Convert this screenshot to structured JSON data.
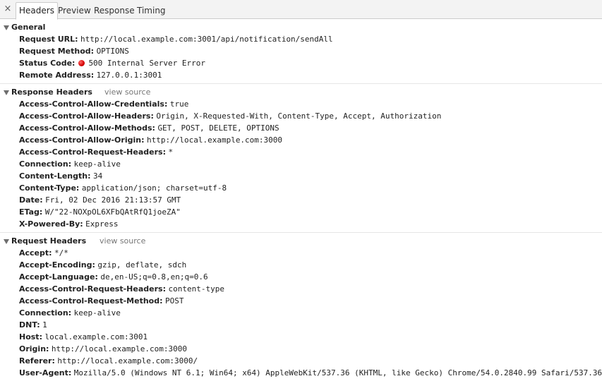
{
  "tabs": {
    "close": "×",
    "items": [
      {
        "label": "Headers",
        "active": true
      },
      {
        "label": "Preview",
        "active": false
      },
      {
        "label": "Response",
        "active": false
      },
      {
        "label": "Timing",
        "active": false
      }
    ]
  },
  "general": {
    "title": "General",
    "rows": [
      {
        "key": "Request URL:",
        "value": "http://local.example.com:3001/api/notification/sendAll"
      },
      {
        "key": "Request Method:",
        "value": "OPTIONS"
      },
      {
        "key": "Status Code:",
        "value": "500 Internal Server Error",
        "status_color": "#d40000"
      },
      {
        "key": "Remote Address:",
        "value": "127.0.0.1:3001"
      }
    ]
  },
  "response_headers": {
    "title": "Response Headers",
    "view_source": "view source",
    "rows": [
      {
        "key": "Access-Control-Allow-Credentials:",
        "value": "true"
      },
      {
        "key": "Access-Control-Allow-Headers:",
        "value": "Origin, X-Requested-With, Content-Type, Accept, Authorization"
      },
      {
        "key": "Access-Control-Allow-Methods:",
        "value": "GET, POST, DELETE, OPTIONS"
      },
      {
        "key": "Access-Control-Allow-Origin:",
        "value": "http://local.example.com:3000"
      },
      {
        "key": "Access-Control-Request-Headers:",
        "value": "*"
      },
      {
        "key": "Connection:",
        "value": "keep-alive"
      },
      {
        "key": "Content-Length:",
        "value": "34"
      },
      {
        "key": "Content-Type:",
        "value": "application/json; charset=utf-8"
      },
      {
        "key": "Date:",
        "value": "Fri, 02 Dec 2016 21:13:57 GMT"
      },
      {
        "key": "ETag:",
        "value": "W/\"22-NOXpOL6XFbQAtRfQ1joeZA\""
      },
      {
        "key": "X-Powered-By:",
        "value": "Express"
      }
    ]
  },
  "request_headers": {
    "title": "Request Headers",
    "view_source": "view source",
    "rows": [
      {
        "key": "Accept:",
        "value": "*/*"
      },
      {
        "key": "Accept-Encoding:",
        "value": "gzip, deflate, sdch"
      },
      {
        "key": "Accept-Language:",
        "value": "de,en-US;q=0.8,en;q=0.6"
      },
      {
        "key": "Access-Control-Request-Headers:",
        "value": "content-type"
      },
      {
        "key": "Access-Control-Request-Method:",
        "value": "POST"
      },
      {
        "key": "Connection:",
        "value": "keep-alive"
      },
      {
        "key": "DNT:",
        "value": "1"
      },
      {
        "key": "Host:",
        "value": "local.example.com:3001"
      },
      {
        "key": "Origin:",
        "value": "http://local.example.com:3000"
      },
      {
        "key": "Referer:",
        "value": "http://local.example.com:3000/"
      },
      {
        "key": "User-Agent:",
        "value": "Mozilla/5.0 (Windows NT 6.1; Win64; x64) AppleWebKit/537.36 (KHTML, like Gecko) Chrome/54.0.2840.99 Safari/537.36"
      }
    ]
  }
}
